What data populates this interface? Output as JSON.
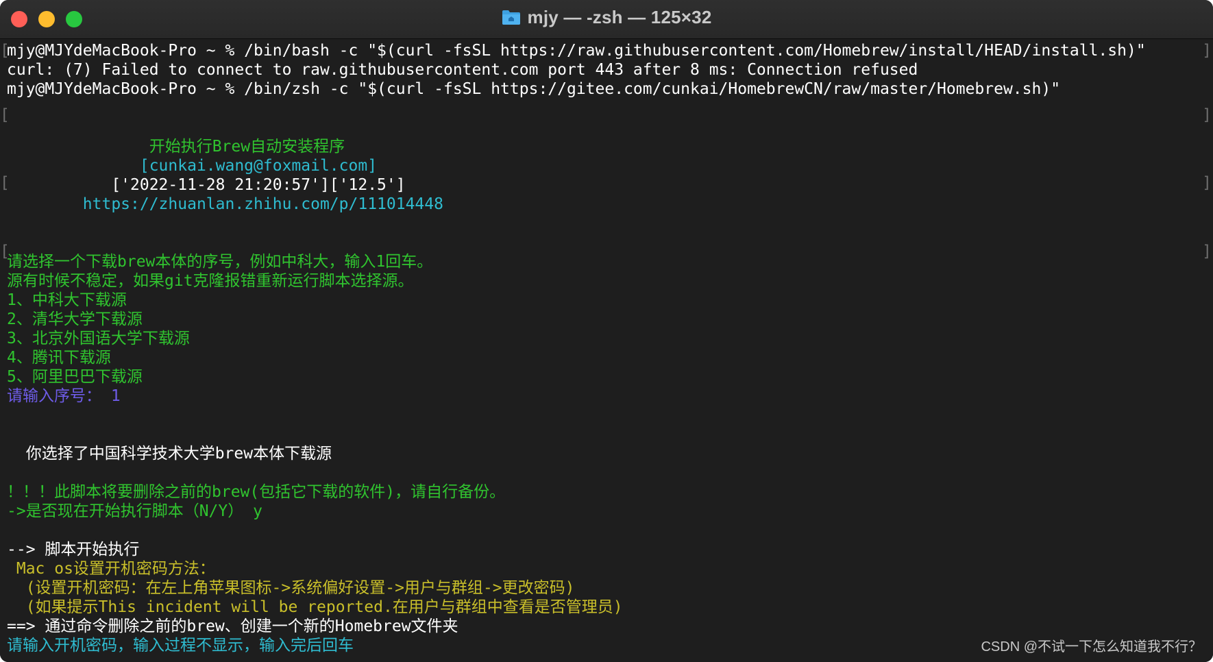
{
  "window": {
    "title": "mjy — -zsh — 125×32"
  },
  "terminal": {
    "lines": [
      "mjy@MJYdeMacBook-Pro ~ % /bin/bash -c \"$(curl -fsSL https://raw.githubusercontent.com/Homebrew/install/HEAD/install.sh)\"",
      "curl: (7) Failed to connect to raw.githubusercontent.com port 443 after 8 ms: Connection refused",
      "mjy@MJYdeMacBook-Pro ~ % /bin/zsh -c \"$(curl -fsSL https://gitee.com/cunkai/HomebrewCN/raw/master/Homebrew.sh)\"",
      "               开始执行Brew自动安装程序",
      "              [cunkai.wang@foxmail.com]",
      "           ['2022-11-28 21:20:57']['12.5']",
      "        https://zhuanlan.zhihu.com/p/111014448",
      "请选择一个下载brew本体的序号，例如中科大，输入1回车。",
      "源有时候不稳定，如果git克隆报错重新运行脚本选择源。",
      "1、中科大下载源",
      "2、清华大学下载源",
      "3、北京外国语大学下载源",
      "4、腾讯下载源",
      "5、阿里巴巴下载源",
      "请输入序号： 1",
      "  你选择了中国科学技术大学brew本体下载源",
      "！！！此脚本将要删除之前的brew(包括它下载的软件)，请自行备份。",
      "->是否现在开始执行脚本（N/Y） y",
      "--> 脚本开始执行",
      " Mac os设置开机密码方法：",
      "  (设置开机密码：在左上角苹果图标->系统偏好设置->用户与群组->更改密码)",
      "  (如果提示This incident will be reported.在用户与群组中查看是否管理员)",
      "==> 通过命令删除之前的brew、创建一个新的Homebrew文件夹",
      "请输入开机密码，输入过程不显示，输入完后回车"
    ]
  },
  "watermark": "CSDN @不试一下怎么知道我不行？",
  "colors": {
    "background": "#1e1e1e",
    "white_text": "#ffffff",
    "green_text": "#30c42f",
    "cyan_text": "#2fbcd0",
    "purple_text": "#6e5ce8",
    "yellow_text": "#c9bf2a"
  }
}
